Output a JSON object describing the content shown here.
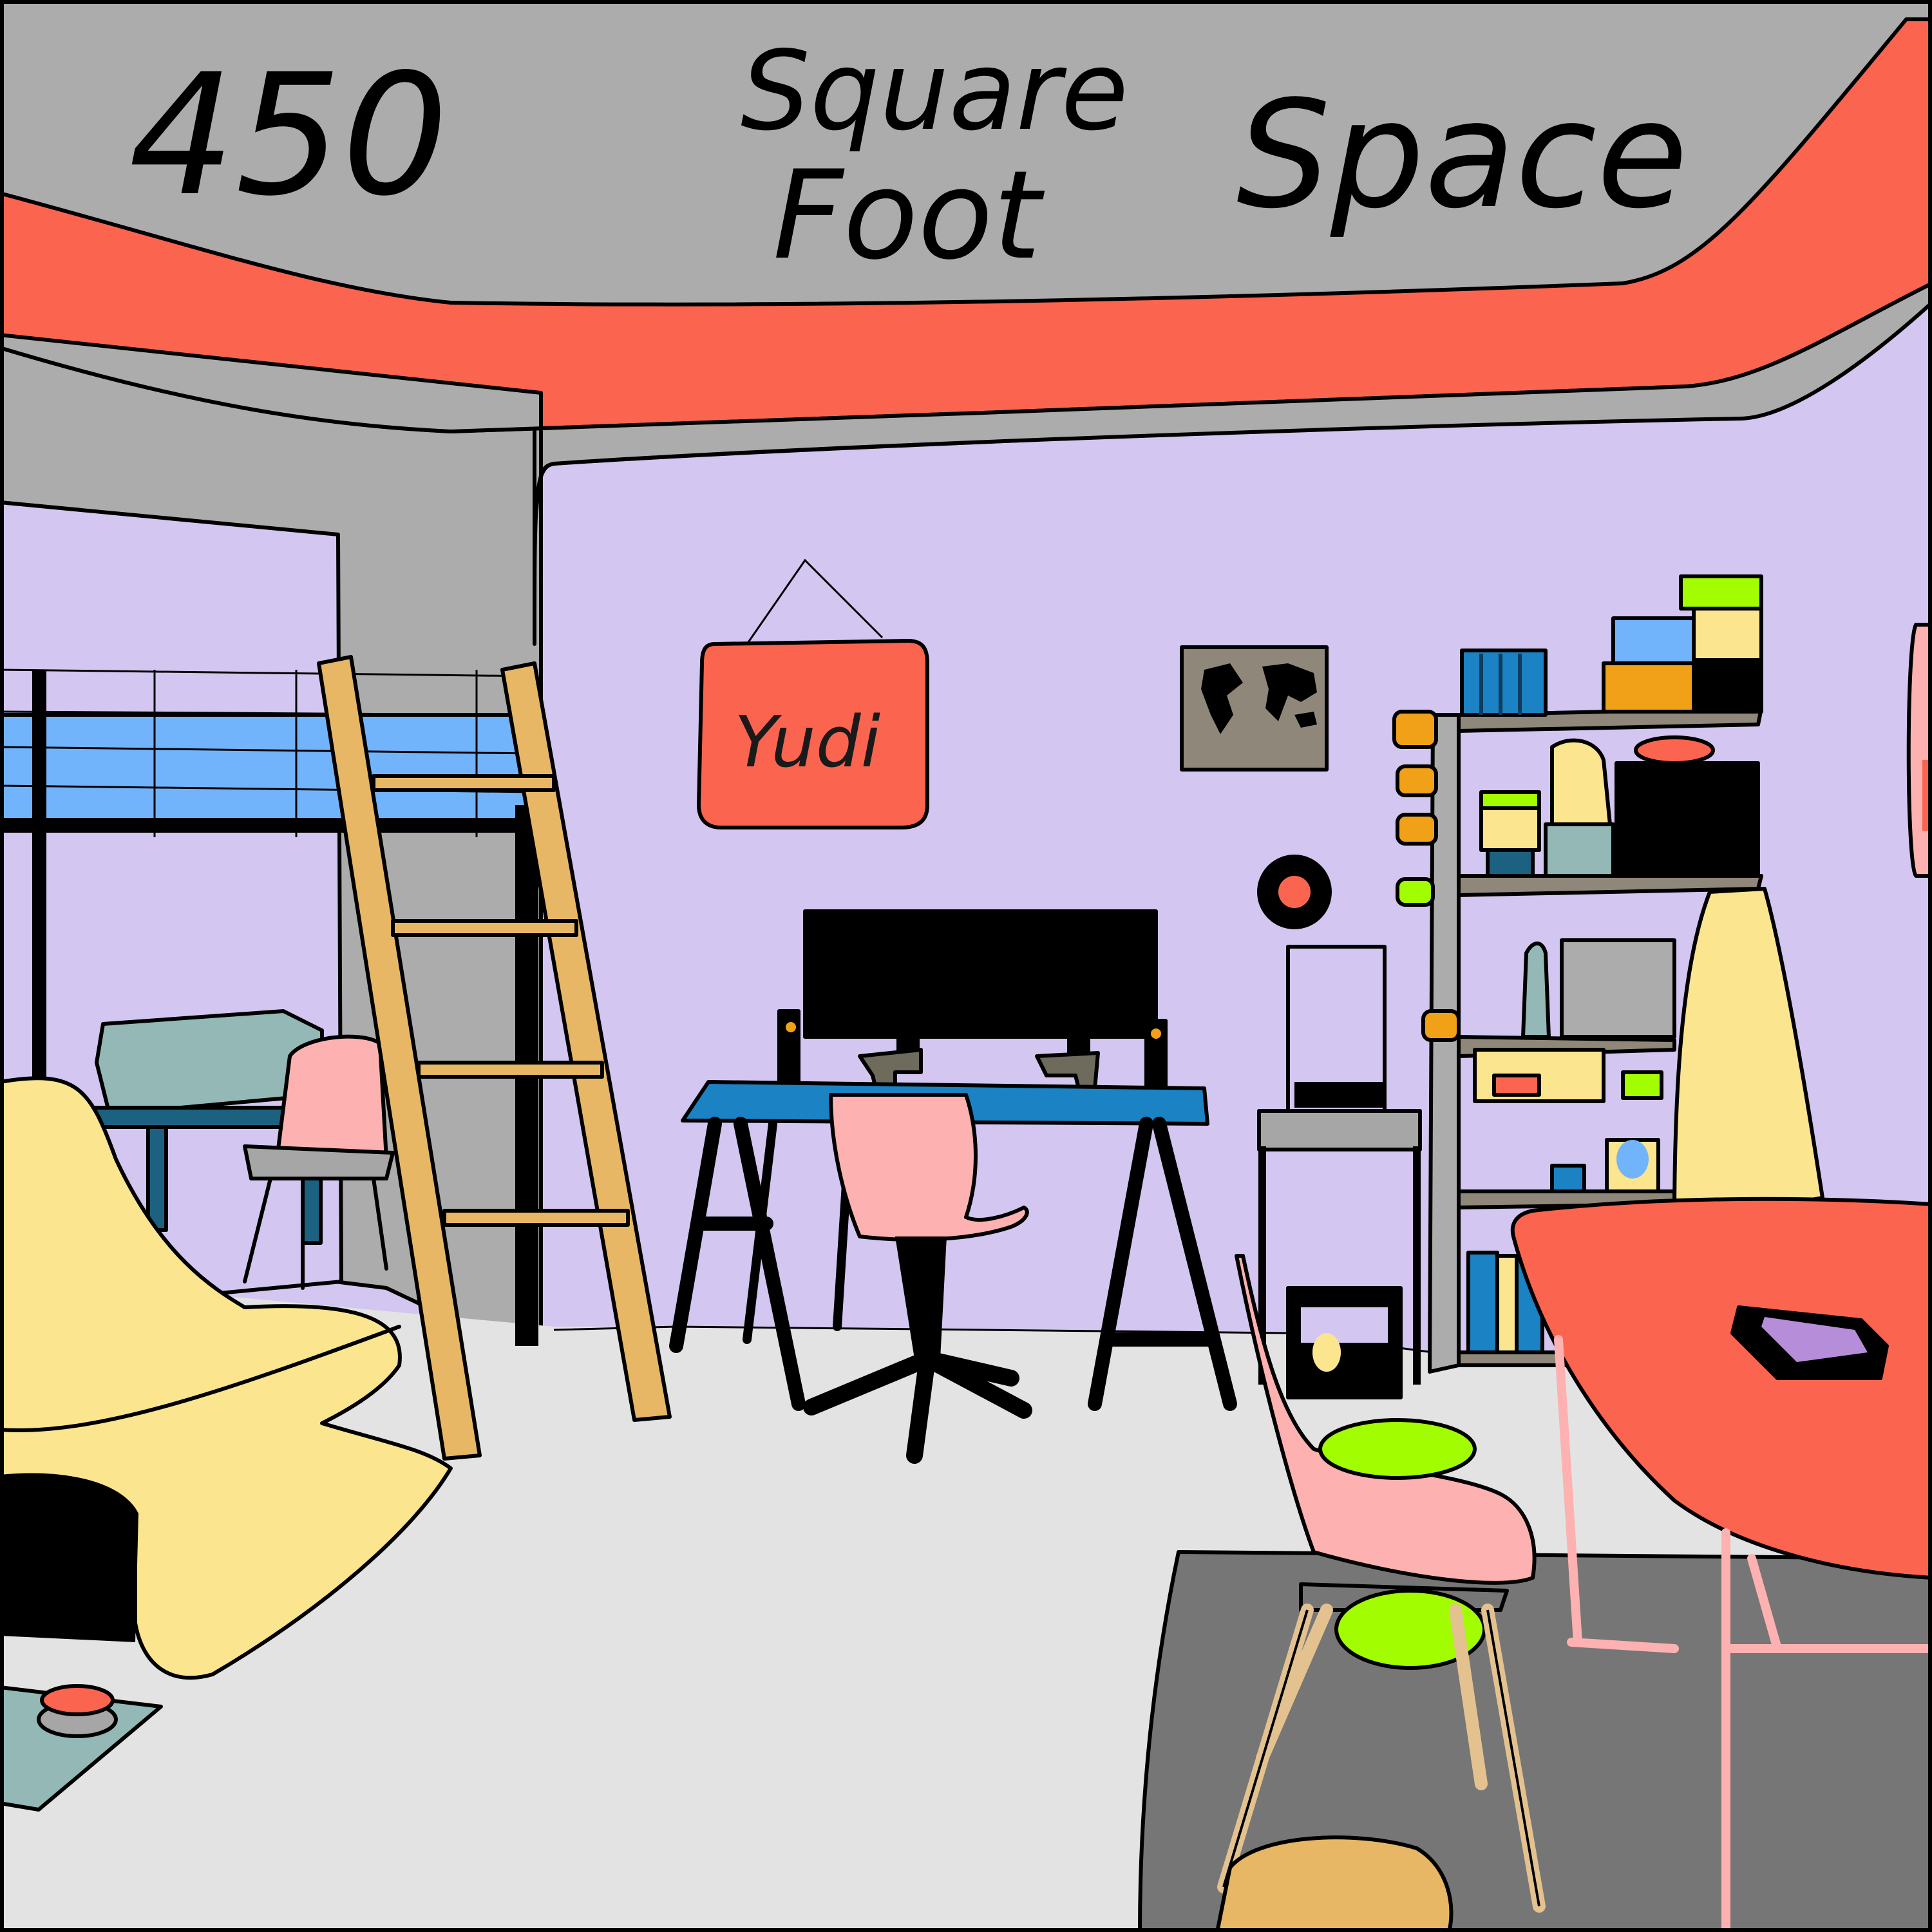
{
  "ceiling_banner": {
    "line_number": "450",
    "line_word_1": "Square",
    "line_word_2": "Foot",
    "line_word_3": "Space"
  },
  "name_sign": {
    "text": "Yudi"
  },
  "colors": {
    "wall": "#d3c6f0",
    "ceiling": "#acacac",
    "stripe": "#fb654f",
    "floor": "#e3e3e3",
    "rug": "#767676",
    "desk_top": "#1b82c4",
    "chair_pink": "#fdb1b1",
    "ladder_wood": "#e8b766",
    "beanbag_yellow": "#fce58f",
    "lime": "#a2fd01",
    "loft_blue": "#72b4fb",
    "table_red": "#fb654f"
  }
}
